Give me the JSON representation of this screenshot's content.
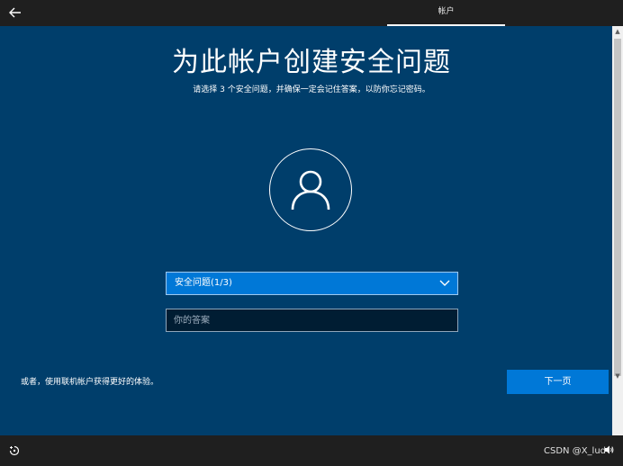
{
  "header": {
    "tab_label": "帐户"
  },
  "main": {
    "title": "为此帐户创建安全问题",
    "subtitle": "请选择 3 个安全问题，并确保一定会记住答案，以防你忘记密码。",
    "question_select": {
      "value": "安全问题(1/3)"
    },
    "answer_field": {
      "placeholder": "你的答案"
    },
    "alt_link": "或者，使用联机帐户获得更好的体验。",
    "next_label": "下一页"
  },
  "footer": {
    "watermark": "CSDN @X_lud"
  },
  "icons": {
    "back": "back-arrow-icon",
    "avatar": "user-icon",
    "select": "chevron-down-icon",
    "accessibility": "ease-of-access-icon",
    "volume": "volume-icon"
  },
  "colors": {
    "background": "#003e6b",
    "accent": "#0078d7",
    "bar": "#1f1f1f",
    "input_background": "#001d33"
  }
}
